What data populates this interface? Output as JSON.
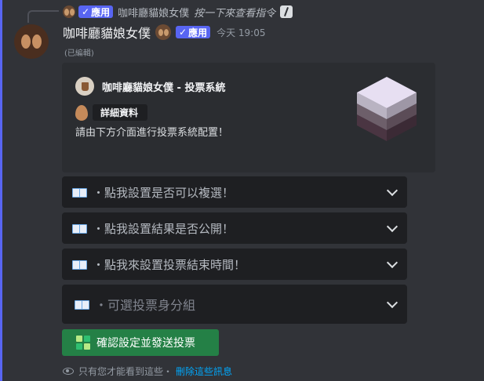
{
  "reply": {
    "badge": "應用",
    "name": "咖啡廳貓娘女僕",
    "hint": "按一下來查看指令"
  },
  "message": {
    "username": "咖啡廳貓娘女僕",
    "badge": "應用",
    "timestamp": "今天 19:05",
    "edited": "(已編輯)"
  },
  "embed": {
    "author": "咖啡廳貓娘女僕 - 投票系統",
    "field_label": "詳細資料",
    "description": "請由下方介面進行投票系統配置！"
  },
  "selects": [
    {
      "label": "・點我設置是否可以複選！"
    },
    {
      "label": "・點我設置結果是否公開！"
    },
    {
      "label": "・點我來設置投票結束時間！"
    },
    {
      "label": "・可選投票身分組"
    }
  ],
  "submit": {
    "label": "確認設定並發送投票"
  },
  "footer": {
    "notice": "只有您才能看到這些・",
    "dismiss": "刪除這些訊息"
  },
  "colors": {
    "background": "#313338",
    "embed": "#2b2d31",
    "select": "#1e1f22",
    "badge": "#5865f2",
    "button": "#248046",
    "link": "#00a8fc"
  },
  "icons": {
    "reply": "bot-avatar-icon",
    "cmd": "slash-command-icon",
    "select": "book-icon",
    "button": "grid-icon",
    "footer": "eye-icon"
  }
}
